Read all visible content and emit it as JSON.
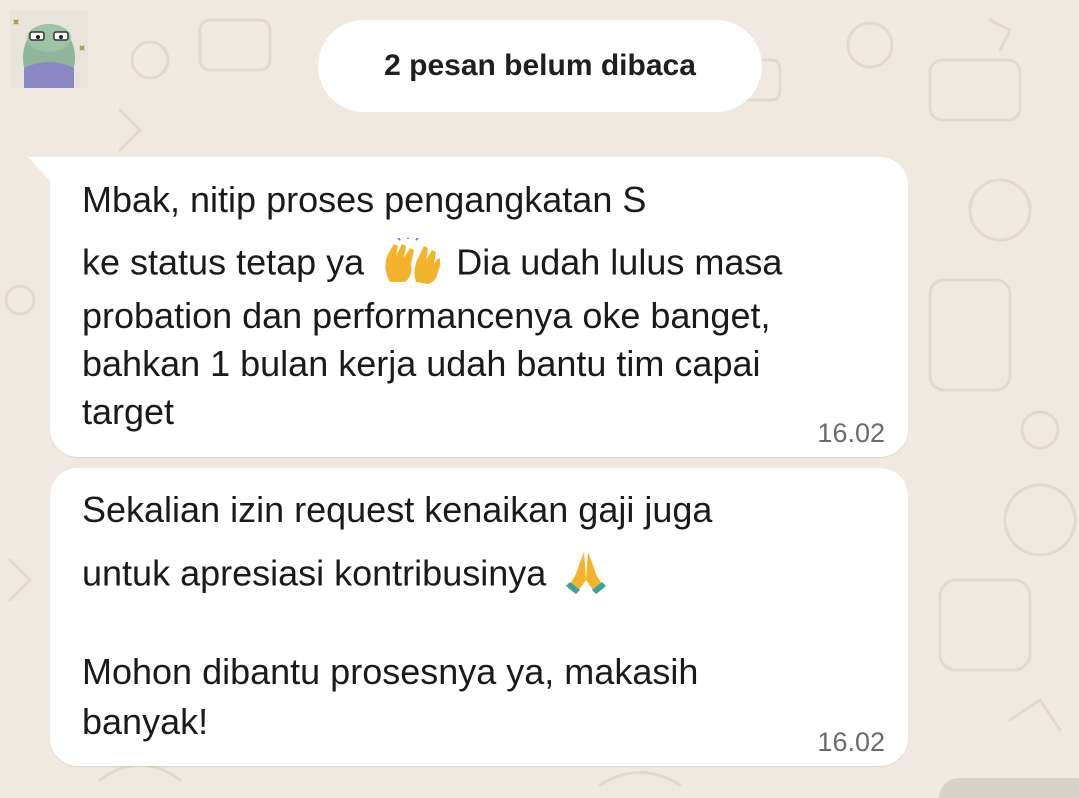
{
  "header": {
    "unread_label": "2 pesan belum dibaca"
  },
  "messages": [
    {
      "lines": [
        "Mbak, nitip proses pengangkatan S",
        "ke status tetap ya",
        "Dia udah lulus masa",
        "probation dan performancenya oke banget,",
        "bahkan 1 bulan kerja udah bantu tim capai",
        "target"
      ],
      "emoji": "raising-hands-icon",
      "time": "16.02"
    },
    {
      "lines": [
        "Sekalian izin request kenaikan gaji juga",
        "untuk apresiasi kontribusinya",
        "Mohon dibantu prosesnya ya, makasih",
        "banyak!"
      ],
      "emoji": "folded-hands-icon",
      "time": "16.02"
    }
  ],
  "colors": {
    "wallpaper": "#efe9e1",
    "bubble": "#ffffff",
    "timestamp": "#6b6b6b"
  }
}
